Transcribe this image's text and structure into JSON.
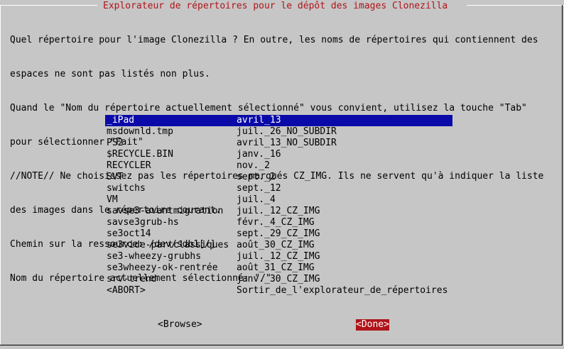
{
  "dialog": {
    "title": "Explorateur de répertoires pour le dépôt des images Clonezilla",
    "message_lines": [
      "Quel répertoire pour l'image Clonezilla ? En outre, les noms de répertoires qui contiennent des",
      "espaces ne sont pas listés non plus.",
      "Quand le \"Nom du répertoire actuellement sélectionné\" vous convient, utilisez la touche \"Tab\"",
      "pour sélectionner \"Fait\"",
      "//NOTE// Ne choisissez pas les répertoires marqués CZ_IMG. Ils ne servent qu'à indiquer la liste",
      "des images dans le répertoire courant.",
      "Chemin sur la ressource: /dev/sdb1[/]",
      "Nom du répertoire actuellement sélectionné: \"/\""
    ]
  },
  "list": {
    "rows": [
      {
        "tag": "_iPad",
        "item": "avril_13",
        "selected": true
      },
      {
        "tag": "msdownld.tmp",
        "item": "juil._26_NO_SUBDIR",
        "selected": false
      },
      {
        "tag": "PS2",
        "item": "avril_13_NO_SUBDIR",
        "selected": false
      },
      {
        "tag": "$RECYCLE.BIN",
        "item": "janv._16",
        "selected": false
      },
      {
        "tag": "RECYCLER",
        "item": "nov._2",
        "selected": false
      },
      {
        "tag": "SVT",
        "item": "sept._2",
        "selected": false
      },
      {
        "tag": "switchs",
        "item": "sept._12",
        "selected": false
      },
      {
        "tag": "VM",
        "item": "juil._4",
        "selected": false
      },
      {
        "tag": "savse3-avantmigration",
        "item": "juil._12_CZ_IMG",
        "selected": false
      },
      {
        "tag": "savse3grub-hs",
        "item": "févr._4_CZ_IMG",
        "selected": false
      },
      {
        "tag": "se3oct14",
        "item": "sept._29_CZ_IMG",
        "selected": false
      },
      {
        "tag": "se3vide-partclassiques",
        "item": "août_30_CZ_IMG",
        "selected": false
      },
      {
        "tag": "se3-wheezy-grubhs",
        "item": "juil._12_CZ_IMG",
        "selected": false
      },
      {
        "tag": "se3wheezy-ok-rentrée",
        "item": "août_31_CZ_IMG",
        "selected": false
      },
      {
        "tag": "srv-trend",
        "item": "janv._30_CZ_IMG",
        "selected": false
      },
      {
        "tag": "<ABORT>",
        "item": "Sortir_de_l'explorateur_de_répertoires",
        "selected": false
      }
    ]
  },
  "buttons": {
    "browse_label": "<Browse>",
    "done_label": "<Done>"
  },
  "colors": {
    "background": "#c6c6c6",
    "title": "#b0141a",
    "selection_bg": "#0a0aa8",
    "selection_fg": "#ffffff",
    "done_bg": "#b0141a"
  }
}
